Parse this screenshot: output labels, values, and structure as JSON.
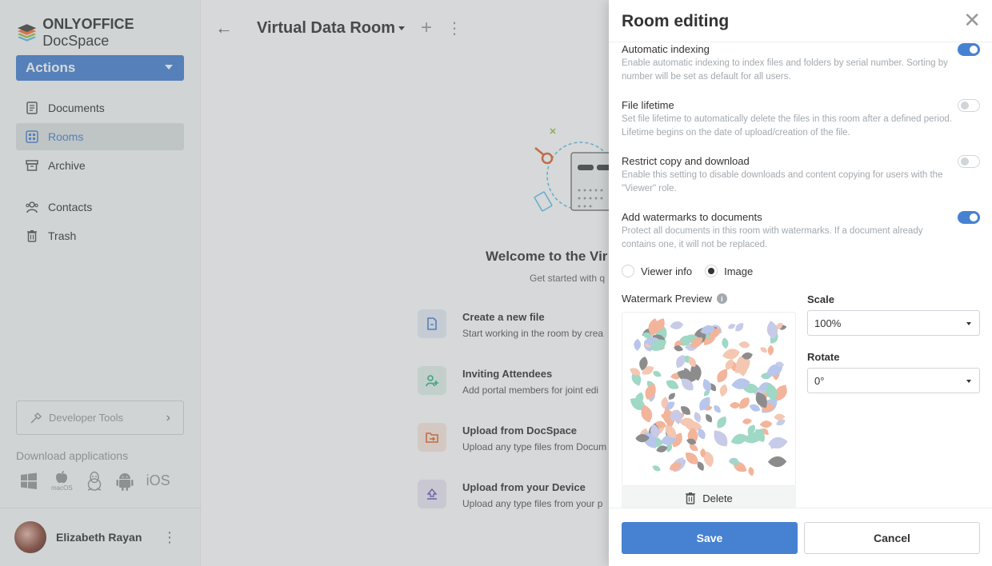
{
  "brand": {
    "name_bold": "ONLYOFFICE",
    "name_light": " DocSpace"
  },
  "sidebar": {
    "actions_label": "Actions",
    "items": [
      {
        "label": "Documents",
        "icon": "document-icon"
      },
      {
        "label": "Rooms",
        "icon": "rooms-icon",
        "active": true
      },
      {
        "label": "Archive",
        "icon": "archive-icon"
      },
      {
        "label": "Contacts",
        "icon": "contacts-icon"
      },
      {
        "label": "Trash",
        "icon": "trash-icon"
      }
    ],
    "developer_tools": "Developer Tools",
    "download_label": "Download applications",
    "apps": [
      "windows",
      "macOS",
      "linux",
      "android",
      "iOS"
    ],
    "user_name": "Elizabeth Rayan"
  },
  "main": {
    "room_title": "Virtual Data Room",
    "welcome_title": "Welcome to the Vir",
    "welcome_sub": "Get started with q",
    "options": [
      {
        "title": "Create a new file",
        "text": "Start working in the room by crea"
      },
      {
        "title": "Inviting Attendees",
        "text": "Add portal members for joint edi"
      },
      {
        "title": "Upload from DocSpace",
        "text": "Upload any type files from Docum"
      },
      {
        "title": "Upload from your Device",
        "text": "Upload any type files from your p"
      }
    ]
  },
  "panel": {
    "title": "Room editing",
    "settings": [
      {
        "title": "Automatic indexing",
        "desc": "Enable automatic indexing to index files and folders by serial number. Sorting by number will be set as default for all users.",
        "enabled": true
      },
      {
        "title": "File lifetime",
        "desc": "Set file lifetime to automatically delete the files in this room after a defined period. Lifetime begins on the date of upload/creation of the file.",
        "enabled": false
      },
      {
        "title": "Restrict copy and download",
        "desc": "Enable this setting to disable downloads and content copying for users with the \"Viewer\" role.",
        "enabled": false
      },
      {
        "title": "Add watermarks to documents",
        "desc": "Protect all documents in this room with watermarks. If a document already contains one, it will not be replaced.",
        "enabled": true
      }
    ],
    "watermark_type": {
      "option_viewer": "Viewer info",
      "option_image": "Image",
      "selected": "Image"
    },
    "preview_label": "Watermark Preview",
    "delete_label": "Delete",
    "scale_label": "Scale",
    "scale_value": "100%",
    "rotate_label": "Rotate",
    "rotate_value": "0°",
    "save_label": "Save",
    "cancel_label": "Cancel"
  },
  "colors": {
    "accent": "#4781d1",
    "muted": "#a3a9ae"
  }
}
